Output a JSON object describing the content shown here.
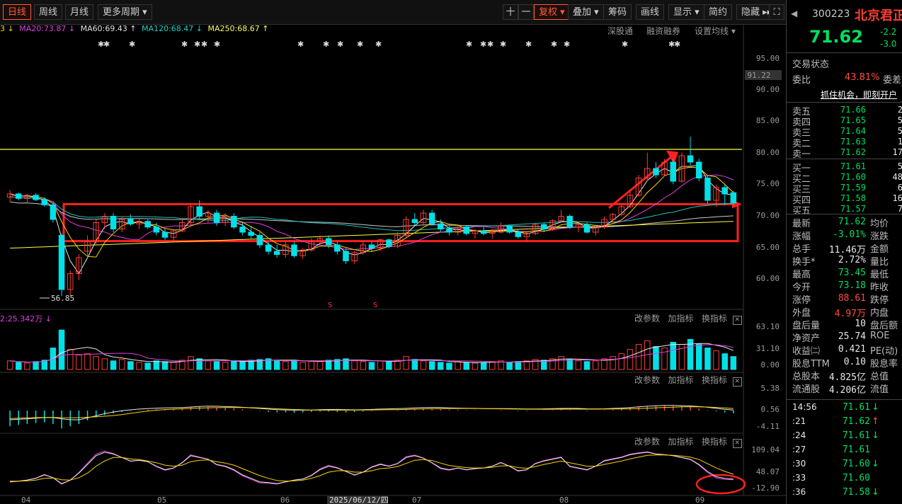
{
  "toolbar": {
    "periods": [
      "日线",
      "周线",
      "月线",
      "更多周期 ▾"
    ],
    "right_buttons": [
      "十",
      "一",
      "复权 ▾",
      "叠加 ▾",
      "筹码",
      "画线",
      "显示 ▾",
      "简约",
      "隐藏 ▸▸"
    ]
  },
  "ma_line": {
    "ma10": "3 ↓",
    "ma20": "MA20:73.87 ↓",
    "ma60": "MA60:69.43 ↑",
    "ma120": "MA120:68.47 ↓",
    "ma250": "MA250:68.67 ↑"
  },
  "top_links": [
    "深股通",
    "融资融券",
    "设置均线 ▾"
  ],
  "price_axis": {
    "current_label": "91.22",
    "low_marker": "56.85",
    "ticks": [
      "95.00",
      "90.00",
      "85.00",
      "80.00",
      "75.00",
      "70.00",
      "65.00",
      "60.00"
    ]
  },
  "volume_header": "2:25.342万 ↓",
  "volume_axis": [
    "63.10",
    "31.10",
    "0.00"
  ],
  "macd_axis": [
    "5.38",
    "0.56",
    "-4.11"
  ],
  "kdj_axis": [
    "109.04",
    "48.07",
    "-12.90"
  ],
  "indicator_controls": [
    "改参数",
    "加指标",
    "换指标"
  ],
  "x_axis": [
    "04",
    "05",
    "06",
    "2025/06/12/四",
    "07",
    "08",
    "09"
  ],
  "chart_colors": {
    "up": "#ff3c32",
    "down": "#00e0e8",
    "ma5": "#e8e8e8",
    "ma10": "#ffd400",
    "ma20": "#e040e0",
    "ma60": "#20c0c0",
    "ma120": "#c8c8c8",
    "ma250": "#ffff40",
    "annotation": "#ff2020"
  },
  "chart_data": {
    "type": "candlestick",
    "ylim": [
      55,
      97
    ],
    "resistance": 80.0,
    "box": [
      65.6,
      71.4
    ],
    "ohlc": [
      [
        72.5,
        73.6,
        71.8,
        73.0
      ],
      [
        73.0,
        73.2,
        72.0,
        72.3
      ],
      [
        72.3,
        73.0,
        71.5,
        72.8
      ],
      [
        72.8,
        73.1,
        71.9,
        72.1
      ],
      [
        72.1,
        72.5,
        71.0,
        71.3
      ],
      [
        71.3,
        71.5,
        68.5,
        69.0
      ],
      [
        66.5,
        66.8,
        57.0,
        58.0
      ],
      [
        58.0,
        61.0,
        57.0,
        60.5
      ],
      [
        60.5,
        63.5,
        59.5,
        63.0
      ],
      [
        64.0,
        66.5,
        63.0,
        65.5
      ],
      [
        65.5,
        69.0,
        65.0,
        68.5
      ],
      [
        68.5,
        70.0,
        67.5,
        69.5
      ],
      [
        69.5,
        70.0,
        67.0,
        67.5
      ],
      [
        67.5,
        69.5,
        67.0,
        69.0
      ],
      [
        69.0,
        69.8,
        68.0,
        68.3
      ],
      [
        68.3,
        69.0,
        67.5,
        68.7
      ],
      [
        68.7,
        69.0,
        67.5,
        67.8
      ],
      [
        67.8,
        68.5,
        66.5,
        67.0
      ],
      [
        67.0,
        67.5,
        65.8,
        66.2
      ],
      [
        66.2,
        67.5,
        65.5,
        67.2
      ],
      [
        67.2,
        69.0,
        67.0,
        68.5
      ],
      [
        68.5,
        71.5,
        68.0,
        71.0
      ],
      [
        71.0,
        72.0,
        69.0,
        69.5
      ],
      [
        69.5,
        70.5,
        68.5,
        70.0
      ],
      [
        70.0,
        70.5,
        68.0,
        68.5
      ],
      [
        68.5,
        70.0,
        68.0,
        69.5
      ],
      [
        69.5,
        70.0,
        67.5,
        67.8
      ],
      [
        67.8,
        68.5,
        66.5,
        67.0
      ],
      [
        67.0,
        68.0,
        66.0,
        66.5
      ],
      [
        66.5,
        67.0,
        64.5,
        65.0
      ],
      [
        65.0,
        65.5,
        63.5,
        64.0
      ],
      [
        64.0,
        65.0,
        63.0,
        63.5
      ],
      [
        63.5,
        65.5,
        63.0,
        65.0
      ],
      [
        65.0,
        65.5,
        63.0,
        63.3
      ],
      [
        63.3,
        64.5,
        62.8,
        64.2
      ],
      [
        64.2,
        66.0,
        64.0,
        65.5
      ],
      [
        65.5,
        66.5,
        65.0,
        66.0
      ],
      [
        66.0,
        66.5,
        64.5,
        65.0
      ],
      [
        65.0,
        65.5,
        63.5,
        64.0
      ],
      [
        64.0,
        64.5,
        62.0,
        62.5
      ],
      [
        62.5,
        64.0,
        62.0,
        63.8
      ],
      [
        63.8,
        65.5,
        63.5,
        65.0
      ],
      [
        65.0,
        65.5,
        64.0,
        64.5
      ],
      [
        64.5,
        66.0,
        64.0,
        65.8
      ],
      [
        65.8,
        66.0,
        64.5,
        64.8
      ],
      [
        64.8,
        67.0,
        64.5,
        66.5
      ],
      [
        66.5,
        69.5,
        66.0,
        69.0
      ],
      [
        69.0,
        70.0,
        68.0,
        68.5
      ],
      [
        68.5,
        70.5,
        68.0,
        70.0
      ],
      [
        70.0,
        70.5,
        68.0,
        68.3
      ],
      [
        68.3,
        69.0,
        67.0,
        67.5
      ],
      [
        67.5,
        68.0,
        66.5,
        67.0
      ],
      [
        67.0,
        68.0,
        66.5,
        67.8
      ],
      [
        67.8,
        68.0,
        66.5,
        66.8
      ],
      [
        66.8,
        67.5,
        66.0,
        67.2
      ],
      [
        67.2,
        67.8,
        66.5,
        66.8
      ],
      [
        66.8,
        67.5,
        66.0,
        67.0
      ],
      [
        67.0,
        68.5,
        66.8,
        68.0
      ],
      [
        68.0,
        68.2,
        66.8,
        67.0
      ],
      [
        67.0,
        67.5,
        66.0,
        66.3
      ],
      [
        66.3,
        67.0,
        65.5,
        66.8
      ],
      [
        66.8,
        68.5,
        66.5,
        68.2
      ],
      [
        68.2,
        68.5,
        67.0,
        67.5
      ],
      [
        67.5,
        69.0,
        67.2,
        68.8
      ],
      [
        68.8,
        70.5,
        68.5,
        69.5
      ],
      [
        69.5,
        69.8,
        67.5,
        67.8
      ],
      [
        67.8,
        68.5,
        67.0,
        68.2
      ],
      [
        68.2,
        68.5,
        66.8,
        67.0
      ],
      [
        67.0,
        68.0,
        66.5,
        67.8
      ],
      [
        67.8,
        69.5,
        67.5,
        69.0
      ],
      [
        69.0,
        70.0,
        68.5,
        69.8
      ],
      [
        69.8,
        71.5,
        69.5,
        71.0
      ],
      [
        71.0,
        73.5,
        70.8,
        72.8
      ],
      [
        72.8,
        76.0,
        72.5,
        75.5
      ],
      [
        75.5,
        79.5,
        75.0,
        77.0
      ],
      [
        77.0,
        78.0,
        75.5,
        76.0
      ],
      [
        76.0,
        78.5,
        75.8,
        78.0
      ],
      [
        78.0,
        78.5,
        74.5,
        75.0
      ],
      [
        75.0,
        79.5,
        74.8,
        79.0
      ],
      [
        79.0,
        82.0,
        77.5,
        78.0
      ],
      [
        78.0,
        78.5,
        75.0,
        75.5
      ],
      [
        75.5,
        76.0,
        71.5,
        72.0
      ],
      [
        72.0,
        74.5,
        71.0,
        74.0
      ],
      [
        74.0,
        74.5,
        71.2,
        73.0
      ],
      [
        73.2,
        73.5,
        71.2,
        71.6
      ]
    ],
    "volume": [
      12,
      10,
      9,
      11,
      13,
      30,
      55,
      28,
      20,
      22,
      18,
      15,
      12,
      14,
      11,
      10,
      9,
      12,
      11,
      10,
      13,
      18,
      15,
      12,
      11,
      10,
      12,
      11,
      13,
      14,
      15,
      12,
      11,
      13,
      10,
      12,
      11,
      13,
      14,
      15,
      12,
      11,
      10,
      12,
      11,
      13,
      18,
      14,
      12,
      11,
      10,
      9,
      11,
      10,
      9,
      10,
      11,
      12,
      10,
      11,
      12,
      14,
      13,
      15,
      18,
      14,
      12,
      11,
      12,
      15,
      18,
      22,
      28,
      35,
      40,
      32,
      30,
      38,
      35,
      42,
      36,
      30,
      26,
      22,
      18
    ],
    "macd": [
      -3.5,
      -3.2,
      -3.0,
      -2.8,
      -2.6,
      -3.0,
      -4.0,
      -3.5,
      -3.0,
      -2.2,
      -1.5,
      -1.0,
      -0.6,
      -0.3,
      -0.1,
      0.1,
      0.2,
      0.3,
      0.3,
      0.4,
      0.5,
      0.8,
      0.9,
      0.8,
      0.7,
      0.6,
      0.5,
      0.3,
      0.1,
      -0.1,
      -0.3,
      -0.4,
      -0.4,
      -0.5,
      -0.4,
      -0.3,
      -0.2,
      -0.2,
      -0.3,
      -0.4,
      -0.3,
      -0.2,
      -0.1,
      0.0,
      0.0,
      0.1,
      0.3,
      0.4,
      0.5,
      0.4,
      0.3,
      0.2,
      0.2,
      0.1,
      0.1,
      0.0,
      0.0,
      0.1,
      0.0,
      -0.1,
      -0.1,
      0.0,
      0.0,
      0.1,
      0.2,
      0.1,
      0.0,
      -0.1,
      0.0,
      0.1,
      0.2,
      0.4,
      0.6,
      0.8,
      1.0,
      1.1,
      1.1,
      1.0,
      0.9,
      0.8,
      0.5,
      0.1,
      -0.2,
      -0.4,
      -0.6
    ],
    "kdj_k": [
      10,
      12,
      15,
      20,
      30,
      22,
      5,
      15,
      35,
      60,
      85,
      95,
      90,
      80,
      70,
      72,
      68,
      55,
      45,
      50,
      65,
      85,
      80,
      75,
      60,
      55,
      45,
      30,
      20,
      10,
      8,
      5,
      10,
      15,
      18,
      28,
      45,
      55,
      50,
      40,
      30,
      38,
      52,
      60,
      55,
      62,
      80,
      85,
      78,
      65,
      50,
      45,
      50,
      45,
      48,
      50,
      55,
      65,
      55,
      42,
      45,
      62,
      70,
      75,
      80,
      55,
      50,
      45,
      55,
      70,
      75,
      80,
      88,
      92,
      95,
      90,
      88,
      85,
      80,
      75,
      60,
      40,
      25,
      20,
      18
    ],
    "kdj_d": [
      12,
      12,
      13,
      15,
      20,
      21,
      16,
      15,
      22,
      35,
      55,
      70,
      80,
      80,
      76,
      74,
      70,
      65,
      58,
      55,
      58,
      68,
      72,
      73,
      68,
      64,
      58,
      48,
      38,
      28,
      20,
      14,
      12,
      13,
      15,
      20,
      28,
      38,
      42,
      42,
      38,
      38,
      42,
      48,
      50,
      54,
      63,
      72,
      74,
      71,
      64,
      57,
      54,
      51,
      50,
      50,
      52,
      56,
      56,
      51,
      49,
      54,
      60,
      65,
      70,
      65,
      60,
      55,
      55,
      60,
      65,
      70,
      76,
      81,
      86,
      87,
      87,
      86,
      84,
      81,
      74,
      62,
      50,
      40,
      32
    ]
  },
  "panel": {
    "code": "300223",
    "name": "北京君正",
    "price": "71.62",
    "change": "-2.2",
    "change_pct": "-3.0",
    "trade_status_label": "交易状态",
    "webi_label": "委比",
    "webi_value": "43.81%",
    "weicha_label": "委差",
    "promo": "抓住机会，即刻开户",
    "asks": [
      {
        "label": "卖五",
        "price": "71.66",
        "vol": "2"
      },
      {
        "label": "卖四",
        "price": "71.65",
        "vol": "5"
      },
      {
        "label": "卖三",
        "price": "71.64",
        "vol": "5"
      },
      {
        "label": "卖二",
        "price": "71.63",
        "vol": "1"
      },
      {
        "label": "卖一",
        "price": "71.62",
        "vol": "17"
      }
    ],
    "bids": [
      {
        "label": "买一",
        "price": "71.61",
        "vol": "5"
      },
      {
        "label": "买二",
        "price": "71.60",
        "vol": "48"
      },
      {
        "label": "买三",
        "price": "71.59",
        "vol": "6"
      },
      {
        "label": "买四",
        "price": "71.58",
        "vol": "16"
      },
      {
        "label": "买五",
        "price": "71.57",
        "vol": "7"
      }
    ],
    "stats": [
      {
        "l1": "最新",
        "v": "71.62",
        "c": "g",
        "l2": "均价"
      },
      {
        "l1": "涨幅",
        "v": "-3.01%",
        "c": "g",
        "l2": "涨跌"
      },
      {
        "l1": "总手",
        "v": "11.46万",
        "c": "w",
        "l2": "金额"
      },
      {
        "l1": "换手*",
        "v": "2.72%",
        "c": "w",
        "l2": "量比"
      },
      {
        "l1": "最高",
        "v": "73.45",
        "c": "g",
        "l2": "最低"
      },
      {
        "l1": "今开",
        "v": "73.18",
        "c": "g",
        "l2": "昨收"
      },
      {
        "l1": "涨停",
        "v": "88.61",
        "c": "r",
        "l2": "跌停"
      },
      {
        "l1": "外盘",
        "v": "4.97万",
        "c": "r",
        "l2": "内盘"
      },
      {
        "l1": "盘后量",
        "v": "10",
        "c": "w",
        "l2": "盘后额"
      },
      {
        "l1": "净资产",
        "v": "25.74",
        "c": "w",
        "l2": "ROE"
      },
      {
        "l1": "收益㈡",
        "v": "0.421",
        "c": "w",
        "l2": "PE(动)"
      },
      {
        "l1": "股息TTM",
        "v": "0.10",
        "c": "w",
        "l2": "股息率"
      },
      {
        "l1": "总股本",
        "v": "4.825亿",
        "c": "w",
        "l2": "总值"
      },
      {
        "l1": "流通股",
        "v": "4.206亿",
        "c": "w",
        "l2": "流值"
      }
    ],
    "ticks": [
      {
        "t": "14:56",
        "p": "71.61",
        "d": "↓",
        "dc": "g"
      },
      {
        "t": ":21",
        "p": "71.62",
        "d": "↑",
        "dc": "r"
      },
      {
        "t": ":24",
        "p": "71.61",
        "d": "↓",
        "dc": "g"
      },
      {
        "t": ":27",
        "p": "71.61",
        "d": "",
        "dc": "g"
      },
      {
        "t": ":30",
        "p": "71.60",
        "d": "↓",
        "dc": "g"
      },
      {
        "t": ":33",
        "p": "71.60",
        "d": "",
        "dc": "g"
      },
      {
        "t": ":36",
        "p": "71.58",
        "d": "↓",
        "dc": "g"
      }
    ]
  }
}
